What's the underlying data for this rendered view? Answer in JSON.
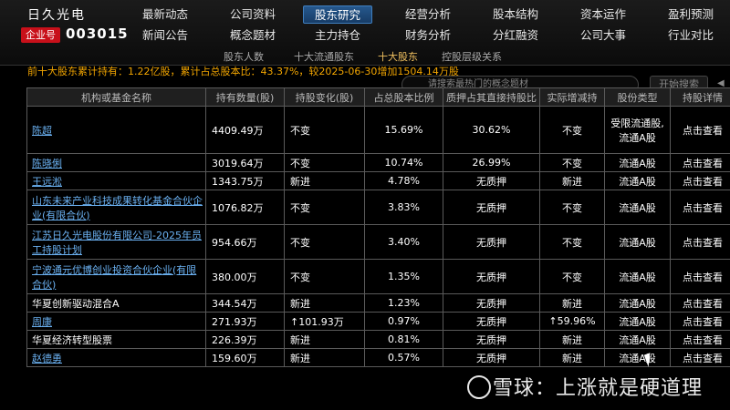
{
  "header": {
    "stock_name": "日久光电",
    "badge": "企业号",
    "stock_code": "003015"
  },
  "nav_row1": [
    "最新动态",
    "公司资料",
    "股东研究",
    "经营分析",
    "股本结构",
    "资本运作",
    "盈利预测"
  ],
  "nav_row2": [
    "新闻公告",
    "概念题材",
    "主力持仓",
    "财务分析",
    "分红融资",
    "公司大事",
    "行业对比"
  ],
  "active_nav": "股东研究",
  "subnav": [
    "股东人数",
    "十大流通股东",
    "十大股东",
    "控股层级关系"
  ],
  "active_subnav": "十大股东",
  "ticker": "前十大股东累计持有：1.22亿股，累计占总股本比：43.37%，较2025-06-30增加1504.14万股",
  "search": {
    "placeholder": "请搜索最热门的概念题材"
  },
  "start_button": "开始搜索",
  "table": {
    "headers": [
      "机构或基金名称",
      "持有数量(股)",
      "持股变化(股)",
      "占总股本比例",
      "质押占其直接持股比",
      "实际增减持",
      "股份类型",
      "持股详情"
    ],
    "rows": [
      {
        "name": "陈超",
        "link": true,
        "qty": "4409.49万",
        "change": "不变",
        "change_color": "gold",
        "ratio": "15.69%",
        "ratio_color": "gold",
        "pledge": "30.62%",
        "pledge_color": "gold",
        "actual": "不变",
        "actual_color": "gold",
        "type": "受限流通股,流通A股",
        "type_color": "gold",
        "detail": "点击查看"
      },
      {
        "name": "陈晓俐",
        "link": true,
        "qty": "3019.64万",
        "change": "不变",
        "change_color": "gold",
        "ratio": "10.74%",
        "ratio_color": "gold",
        "pledge": "26.99%",
        "pledge_color": "gold",
        "actual": "不变",
        "actual_color": "gold",
        "type": "流通A股",
        "type_color": "white",
        "detail": "点击查看"
      },
      {
        "name": "王远淞",
        "link": true,
        "qty": "1343.75万",
        "change": "新进",
        "change_color": "red",
        "ratio": "4.78%",
        "ratio_color": "gold",
        "pledge": "无质押",
        "pledge_color": "gold",
        "actual": "新进",
        "actual_color": "red",
        "type": "流通A股",
        "type_color": "white",
        "detail": "点击查看"
      },
      {
        "name": "山东未来产业科技成果转化基金合伙企业(有限合伙)",
        "link": true,
        "qty": "1076.82万",
        "change": "不变",
        "change_color": "gold",
        "ratio": "3.83%",
        "ratio_color": "gold",
        "pledge": "无质押",
        "pledge_color": "gold",
        "actual": "不变",
        "actual_color": "gold",
        "type": "流通A股",
        "type_color": "white",
        "detail": "点击查看"
      },
      {
        "name": "江苏日久光电股份有限公司-2025年员工持股计划",
        "link": true,
        "qty": "954.66万",
        "change": "不变",
        "change_color": "gold",
        "ratio": "3.40%",
        "ratio_color": "gold",
        "pledge": "无质押",
        "pledge_color": "gold",
        "actual": "不变",
        "actual_color": "gold",
        "type": "流通A股",
        "type_color": "white",
        "detail": "点击查看"
      },
      {
        "name": "宁波通元优博创业投资合伙企业(有限合伙)",
        "link": true,
        "qty": "380.00万",
        "change": "不变",
        "change_color": "gold",
        "ratio": "1.35%",
        "ratio_color": "gold",
        "pledge": "无质押",
        "pledge_color": "gold",
        "actual": "不变",
        "actual_color": "gold",
        "type": "流通A股",
        "type_color": "white",
        "detail": "点击查看"
      },
      {
        "name": "华夏创新驱动混合A",
        "link": false,
        "qty": "344.54万",
        "change": "新进",
        "change_color": "red",
        "ratio": "1.23%",
        "ratio_color": "gold",
        "pledge": "无质押",
        "pledge_color": "gold",
        "actual": "新进",
        "actual_color": "red",
        "type": "流通A股",
        "type_color": "white",
        "detail": "点击查看"
      },
      {
        "name": "周康",
        "link": true,
        "qty": "271.93万",
        "change": "↑101.93万",
        "change_color": "red",
        "ratio": "0.97%",
        "ratio_color": "gold",
        "pledge": "无质押",
        "pledge_color": "gold",
        "actual": "↑59.96%",
        "actual_color": "red",
        "type": "流通A股",
        "type_color": "white",
        "detail": "点击查看"
      },
      {
        "name": "华夏经济转型股票",
        "link": false,
        "qty": "226.39万",
        "change": "新进",
        "change_color": "red",
        "ratio": "0.81%",
        "ratio_color": "gold",
        "pledge": "无质押",
        "pledge_color": "gold",
        "actual": "新进",
        "actual_color": "red",
        "type": "流通A股",
        "type_color": "white",
        "detail": "点击查看"
      },
      {
        "name": "赵德勇",
        "link": true,
        "qty": "159.60万",
        "change": "新进",
        "change_color": "red",
        "ratio": "0.57%",
        "ratio_color": "gold",
        "pledge": "无质押",
        "pledge_color": "gold",
        "actual": "新进",
        "actual_color": "red",
        "type": "流通A股",
        "type_color": "white",
        "detail": "点击查看"
      }
    ]
  },
  "watermark": "雪球：上涨就是硬道理"
}
